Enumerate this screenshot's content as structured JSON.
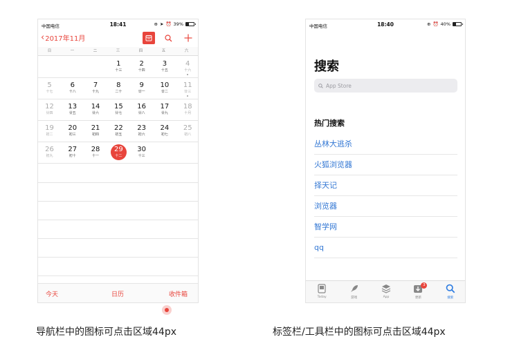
{
  "calendar_phone": {
    "status": {
      "carrier": "中国电信",
      "time": "18:41",
      "battery": "39%",
      "battery_level": 0.39
    },
    "nav": {
      "back_label": "2017年11月",
      "icons": [
        "calendar-icon",
        "search-icon",
        "plus-icon"
      ]
    },
    "weekdays": [
      "日",
      "一",
      "二",
      "三",
      "四",
      "五",
      "六"
    ],
    "weeks": [
      [
        null,
        null,
        null,
        {
          "n": "1",
          "l": "十三"
        },
        {
          "n": "2",
          "l": "十四"
        },
        {
          "n": "3",
          "l": "十五"
        },
        {
          "n": "4",
          "l": "十六",
          "dot": true
        }
      ],
      [
        {
          "n": "5",
          "l": "十七"
        },
        {
          "n": "6",
          "l": "十八"
        },
        {
          "n": "7",
          "l": "十九"
        },
        {
          "n": "8",
          "l": "二十"
        },
        {
          "n": "9",
          "l": "廿一"
        },
        {
          "n": "10",
          "l": "廿二"
        },
        {
          "n": "11",
          "l": "廿三",
          "dot": true
        }
      ],
      [
        {
          "n": "12",
          "l": "廿四"
        },
        {
          "n": "13",
          "l": "廿五"
        },
        {
          "n": "14",
          "l": "廿六"
        },
        {
          "n": "15",
          "l": "廿七"
        },
        {
          "n": "16",
          "l": "廿八"
        },
        {
          "n": "17",
          "l": "廿九"
        },
        {
          "n": "18",
          "l": "十月"
        }
      ],
      [
        {
          "n": "19",
          "l": "初二"
        },
        {
          "n": "20",
          "l": "初三"
        },
        {
          "n": "21",
          "l": "初四"
        },
        {
          "n": "22",
          "l": "初五"
        },
        {
          "n": "23",
          "l": "初六"
        },
        {
          "n": "24",
          "l": "初七"
        },
        {
          "n": "25",
          "l": "初八"
        }
      ],
      [
        {
          "n": "26",
          "l": "初九"
        },
        {
          "n": "27",
          "l": "初十"
        },
        {
          "n": "28",
          "l": "十一"
        },
        {
          "n": "29",
          "l": "十二",
          "selected": true
        },
        {
          "n": "30",
          "l": "十三"
        },
        null,
        null
      ]
    ],
    "toolbar": {
      "today": "今天",
      "calendars": "日历",
      "inbox": "收件箱"
    },
    "accent_color": "#e8453c"
  },
  "appstore_phone": {
    "status": {
      "carrier": "中国电信",
      "time": "18:40",
      "battery": "40%",
      "battery_level": 0.4
    },
    "title": "搜索",
    "search_placeholder": "App Store",
    "hot_title": "热门搜索",
    "hot_items": [
      "丛林大逃杀",
      "火狐浏览器",
      "择天记",
      "浏览器",
      "智学网",
      "qq"
    ],
    "tabs": [
      {
        "label": "Today",
        "icon": "today-icon"
      },
      {
        "label": "游戏",
        "icon": "rocket-icon"
      },
      {
        "label": "App",
        "icon": "layers-icon"
      },
      {
        "label": "更新",
        "icon": "updates-icon",
        "badge": "3"
      },
      {
        "label": "搜索",
        "icon": "search-icon",
        "active": true
      }
    ],
    "link_color": "#3478d4"
  },
  "captions": {
    "left": "导航栏中的图标可点击区域44px",
    "right": "标签栏/工具栏中的图标可点击区域44px"
  }
}
